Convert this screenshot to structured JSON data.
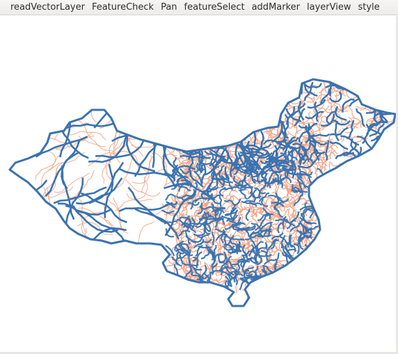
{
  "menubar": {
    "items": [
      "readVectorLayer",
      "FeatureCheck",
      "Pan",
      "featureSelect",
      "addMarker",
      "layerView",
      "style"
    ]
  },
  "map": {
    "boundary_color": "#3a73b0",
    "road_color": "#f4a284",
    "fill_color": "#ffffff"
  }
}
